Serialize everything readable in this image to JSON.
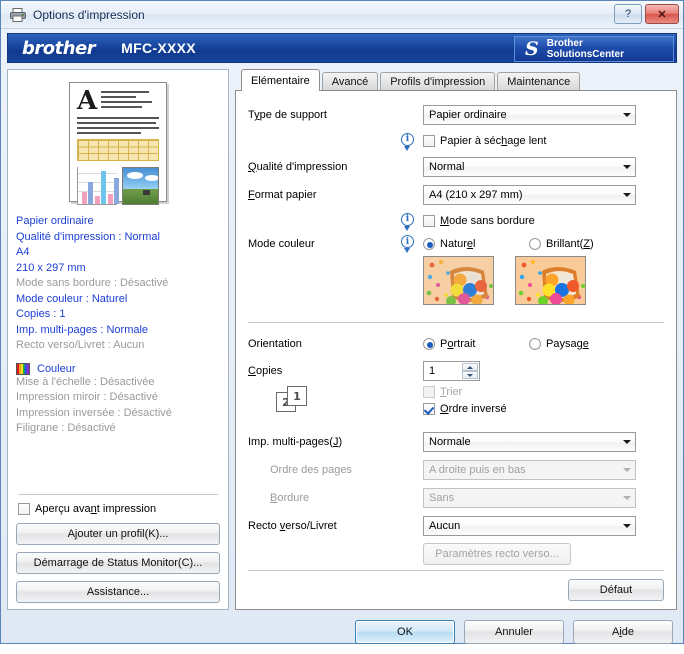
{
  "window": {
    "title": "Options d'impression",
    "help_button": "?",
    "close_button": "✕",
    "printer_icon": "printer-icon"
  },
  "banner": {
    "brand": "brother",
    "model": "MFC-XXXX",
    "solutions_center_line1": "Brother",
    "solutions_center_line2": "SolutionsCenter",
    "solutions_center_glyph": "S",
    "brand_blue": "#113a8f"
  },
  "sidebar": {
    "preview_alt": "document-preview",
    "settings": [
      {
        "text": "Papier ordinaire",
        "state": "on"
      },
      {
        "text": "Qualité d'impression : Normal",
        "state": "on"
      },
      {
        "text": "A4",
        "state": "on"
      },
      {
        "text": "210 x 297 mm",
        "state": "on"
      },
      {
        "text": "Mode sans bordure : Désactivé",
        "state": "off"
      },
      {
        "text": "Mode couleur : Naturel",
        "state": "on"
      },
      {
        "text": "Copies : 1",
        "state": "on"
      },
      {
        "text": "Imp. multi-pages : Normale",
        "state": "on"
      },
      {
        "text": "Recto verso/Livret : Aucun",
        "state": "off"
      }
    ],
    "color_label": "Couleur",
    "settings2": [
      {
        "text": "Mise à l'échelle : Désactivée",
        "state": "off"
      },
      {
        "text": "Impression miroir : Désactivé",
        "state": "off"
      },
      {
        "text": "Impression inversée : Désactivé",
        "state": "off"
      },
      {
        "text": "Filigrane : Désactivé",
        "state": "off"
      }
    ],
    "preview_checkbox": {
      "label": "Aperçu avant impression",
      "checked": false
    },
    "buttons": {
      "add_profile": "Ajouter un profil(K)...",
      "status_monitor": "Démarrage de Status Monitor(C)...",
      "support": "Assistance..."
    },
    "active_color": "#1c3fd6",
    "inactive_color": "#9a9a9a"
  },
  "tabs": [
    {
      "label": "Elémentaire",
      "active": true
    },
    {
      "label": "Avancé",
      "active": false
    },
    {
      "label": "Profils d'impression",
      "active": false
    },
    {
      "label": "Maintenance",
      "active": false
    }
  ],
  "form": {
    "media_type": {
      "label": "Type de support",
      "value": "Papier ordinaire"
    },
    "slow_dry": {
      "label": "Papier à séchage lent",
      "checked": false
    },
    "print_quality": {
      "label": "Qualité d'impression",
      "value": "Normal"
    },
    "paper_size": {
      "label": "Format papier",
      "value": "A4 (210 x 297 mm)"
    },
    "borderless": {
      "label": "Mode sans bordure",
      "checked": false
    },
    "color_mode": {
      "label": "Mode couleur",
      "options": [
        {
          "label": "Naturel",
          "selected": true
        },
        {
          "label": "Brillant(Z)",
          "selected": false
        }
      ]
    },
    "orientation": {
      "label": "Orientation",
      "options": [
        {
          "label": "Portrait",
          "selected": true
        },
        {
          "label": "Paysage",
          "selected": false
        }
      ]
    },
    "copies": {
      "label": "Copies",
      "value": "1"
    },
    "collate": {
      "label": "Trier",
      "checked": false,
      "disabled": true
    },
    "reverse_order": {
      "label": "Ordre inversé",
      "checked": true,
      "disabled": false
    },
    "pages_icon": {
      "back": "2",
      "front": "1"
    },
    "multipage": {
      "label": "Imp. multi-pages(J)",
      "value": "Normale"
    },
    "page_order": {
      "label": "Ordre des pages",
      "value": "A droite puis en bas",
      "disabled": true
    },
    "border": {
      "label": "Bordure",
      "value": "Sans",
      "disabled": true
    },
    "duplex": {
      "label": "Recto verso/Livret",
      "value": "Aucun"
    },
    "duplex_settings_button": {
      "label": "Paramètres recto verso...",
      "disabled": true
    },
    "default_button": "Défaut"
  },
  "footer": {
    "ok": "OK",
    "cancel": "Annuler",
    "help": "Aide"
  }
}
